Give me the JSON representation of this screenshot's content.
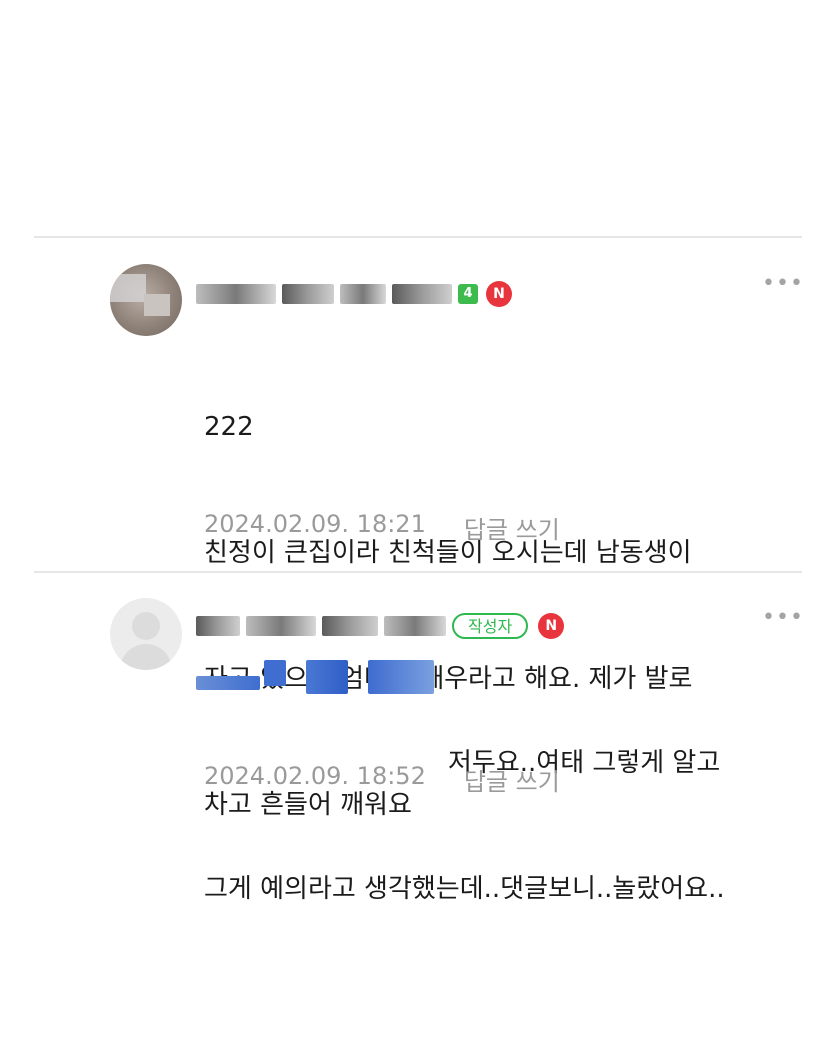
{
  "comments": [
    {
      "level_badge": "4",
      "new_badge": "N",
      "more_icon": "more-dots-icon",
      "lines": [
        "222",
        "친정이 큰집이라 친척들이 오시는데 남동생이",
        "자고 있으면 엄마가 깨우라고 해요. 제가 발로",
        "차고 흔들어 깨워요"
      ],
      "timestamp": "2024.02.09. 18:21",
      "reply_label": "답글 쓰기"
    },
    {
      "writer_badge": "작성자",
      "new_badge": "N",
      "more_icon": "more-dots-icon",
      "lines": [
        "저두요..여태 그렇게 알고",
        "그게 예의라고 생각했는데..댓글보니..놀랐어요.."
      ],
      "timestamp": "2024.02.09. 18:52",
      "reply_label": "답글 쓰기"
    }
  ],
  "colors": {
    "accent_green": "#2fb84f",
    "new_red": "#e8343d",
    "meta_gray": "#9a9a9a",
    "divider": "#e6e6e6"
  }
}
